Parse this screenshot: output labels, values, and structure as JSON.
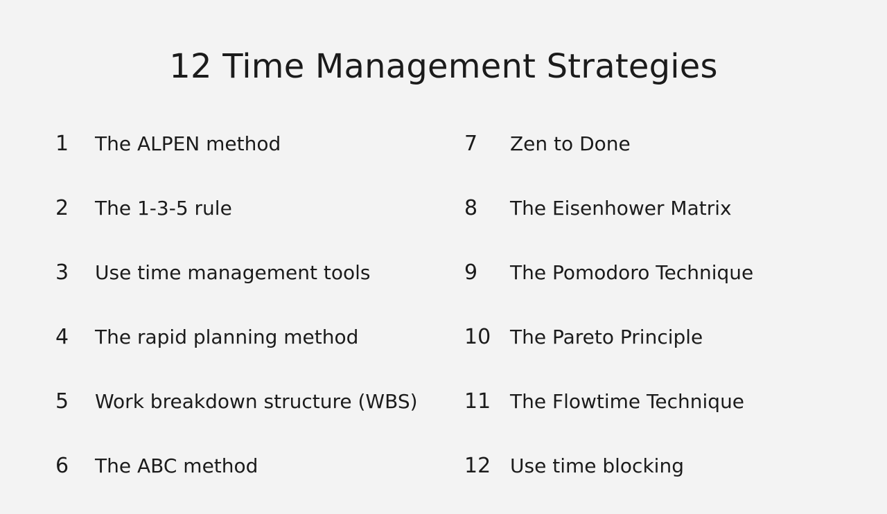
{
  "title": "12 Time Management Strategies",
  "strategies": [
    {
      "number": "1",
      "text": "The ALPEN method"
    },
    {
      "number": "2",
      "text": "The 1-3-5 rule"
    },
    {
      "number": "3",
      "text": "Use time management tools"
    },
    {
      "number": "4",
      "text": "The rapid planning method"
    },
    {
      "number": "5",
      "text": "Work breakdown structure (WBS)"
    },
    {
      "number": "6",
      "text": "The ABC method"
    },
    {
      "number": "7",
      "text": "Zen to Done"
    },
    {
      "number": "8",
      "text": "The Eisenhower Matrix"
    },
    {
      "number": "9",
      "text": "The Pomodoro Technique"
    },
    {
      "number": "10",
      "text": "The Pareto Principle"
    },
    {
      "number": "11",
      "text": "The Flowtime Technique"
    },
    {
      "number": "12",
      "text": "Use time blocking"
    }
  ]
}
